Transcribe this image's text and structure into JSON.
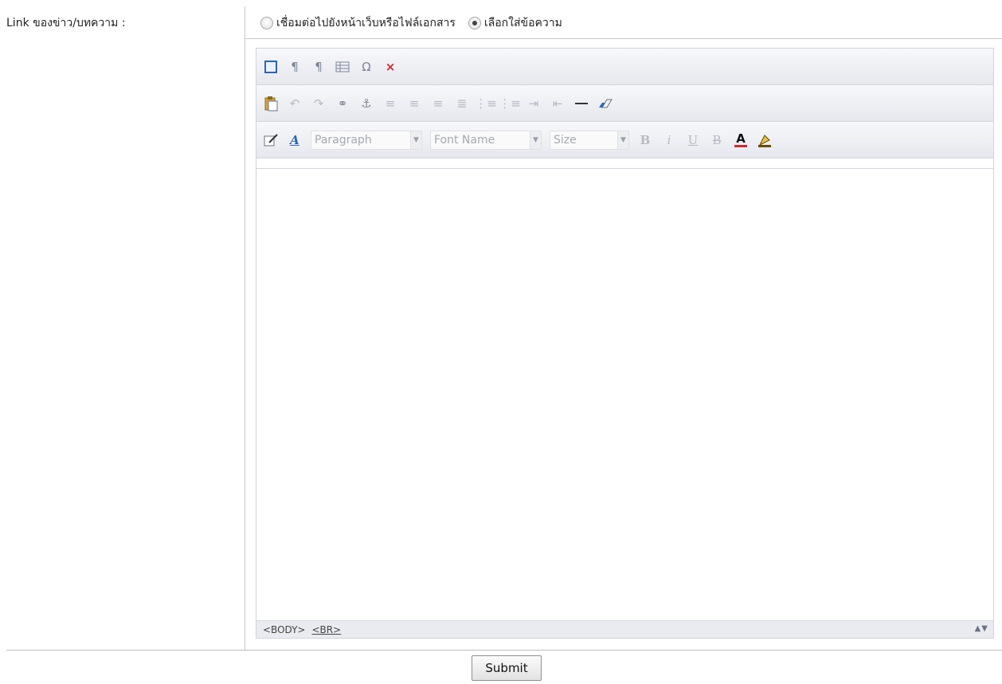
{
  "form": {
    "label": "Link ของข่าว/บทความ :",
    "radio_options": [
      {
        "label": "เชื่อมต่อไปยังหน้าเว็บหรือไฟล์เอกสาร",
        "checked": false
      },
      {
        "label": "เลือกใส่ข้อความ",
        "checked": true
      }
    ]
  },
  "editor": {
    "toolbar1": [
      "show-blocks-icon",
      "ltr-icon",
      "rtl-icon",
      "table-icon",
      "special-char-icon",
      "remove-format-icon"
    ],
    "toolbar2": [
      "paste-icon",
      "undo-icon",
      "redo-icon",
      "link-icon",
      "anchor-icon",
      "align-left-icon",
      "align-center-icon",
      "align-right-icon",
      "justify-icon",
      "ordered-list-icon",
      "unordered-list-icon",
      "indent-icon",
      "outdent-icon",
      "horizontal-rule-icon",
      "eraser-icon"
    ],
    "format_select": "Paragraph",
    "font_select": "Font Name",
    "size_select": "Size",
    "text_buttons": {
      "bold": "B",
      "italic": "i",
      "underline": "U",
      "strike": "B",
      "text_color": "A"
    },
    "status": {
      "tags": [
        "<BODY>",
        "<BR>"
      ],
      "resize": "▲▼"
    }
  },
  "submit": {
    "label": "Submit"
  }
}
